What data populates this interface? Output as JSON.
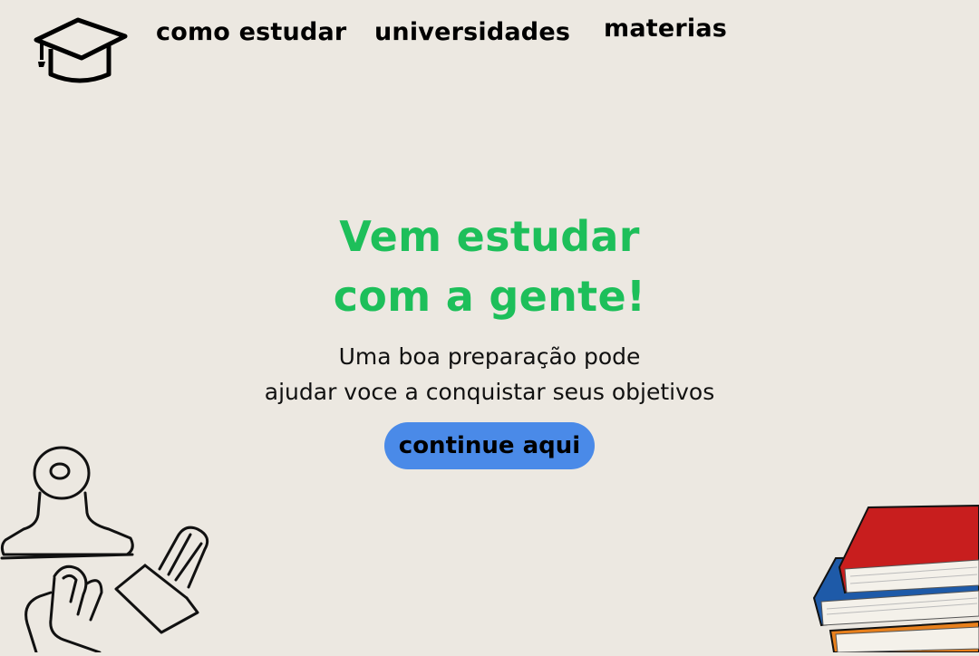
{
  "nav": {
    "items": [
      {
        "label": "como estudar"
      },
      {
        "label": "universidades"
      },
      {
        "label": "materias"
      }
    ]
  },
  "hero": {
    "title_line1": "Vem estudar",
    "title_line2": "com a gente!",
    "subtitle_line1": "Uma boa preparação pode",
    "subtitle_line2": "ajudar voce a conquistar seus objetivos",
    "cta_label": "continue aqui"
  },
  "icons": {
    "logo": "graduation-cap-icon",
    "decor_left": "binder-clips-illustration",
    "decor_right": "book-stack-illustration"
  },
  "colors": {
    "background": "#ece8e1",
    "title": "#1dbf5a",
    "cta": "#4a8ae8",
    "text": "#111111"
  }
}
